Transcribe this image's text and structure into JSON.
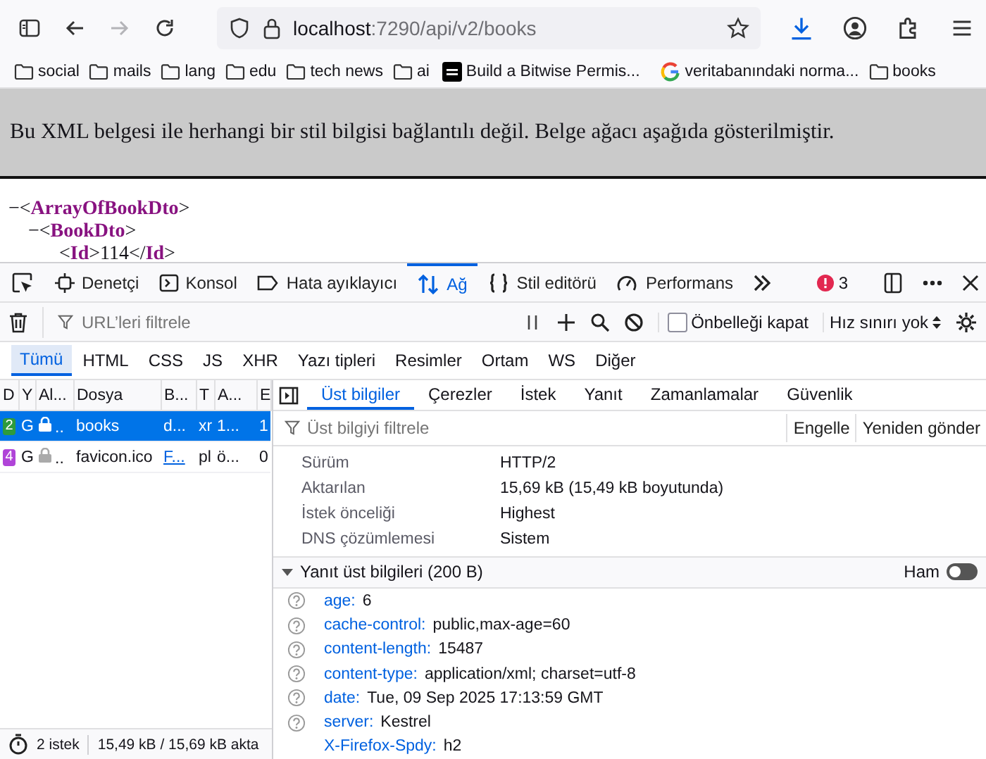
{
  "browser": {
    "nav": [
      {
        "kind": "sidebar",
        "disabled": false
      },
      {
        "kind": "back",
        "disabled": false
      },
      {
        "kind": "forward",
        "disabled": true
      },
      {
        "kind": "reload",
        "disabled": false
      }
    ],
    "address": {
      "host": "localhost",
      "path": ":7290/api/v2/books"
    },
    "bookmarks": [
      {
        "kind": "folder",
        "label": "social"
      },
      {
        "kind": "folder",
        "label": "mails"
      },
      {
        "kind": "folder",
        "label": "lang"
      },
      {
        "kind": "folder",
        "label": "edu"
      },
      {
        "kind": "folder",
        "label": "tech news"
      },
      {
        "kind": "folder",
        "label": "ai"
      },
      {
        "kind": "dev",
        "label": "Build a Bitwise Permis..."
      },
      {
        "kind": "google",
        "label": "veritabanındaki norma..."
      },
      {
        "kind": "folder",
        "label": "books"
      }
    ]
  },
  "page": {
    "notice": "Bu XML belgesi ile herhangi bir stil bilgisi bağlantılı değil. Belge ağacı aşağıda gösterilmiştir.",
    "xml": [
      {
        "segments": [
          {
            "kind": "mark",
            "text": "−<"
          },
          {
            "kind": "tag",
            "text": "ArrayOfBookDto"
          },
          {
            "kind": "mark",
            "text": ">"
          }
        ],
        "children": [
          {
            "segments": [
              {
                "kind": "mark",
                "text": "−<"
              },
              {
                "kind": "tag",
                "text": "BookDto"
              },
              {
                "kind": "mark",
                "text": ">"
              }
            ],
            "children": [
              {
                "segments": [
                  {
                    "kind": "mark",
                    "text": "<"
                  },
                  {
                    "kind": "tag",
                    "text": "Id"
                  },
                  {
                    "kind": "mark",
                    "text": ">114</"
                  },
                  {
                    "kind": "tag",
                    "text": "Id"
                  },
                  {
                    "kind": "mark",
                    "text": ">"
                  }
                ]
              }
            ]
          }
        ]
      }
    ]
  },
  "devtools": {
    "tools": [
      {
        "kind": "inspector",
        "label": "Denetçi",
        "selected": false
      },
      {
        "kind": "console",
        "label": "Konsol",
        "selected": false
      },
      {
        "kind": "debugger",
        "label": "Hata ayıklayıcı",
        "selected": false
      },
      {
        "kind": "network",
        "label": "Ağ",
        "selected": true
      },
      {
        "kind": "style",
        "label": "Stil editörü",
        "selected": false
      },
      {
        "kind": "performance",
        "label": "Performans",
        "selected": false
      }
    ],
    "error_count": "3",
    "filter": {
      "placeholder": "URL’leri filtrele"
    },
    "disable_cache": {
      "label": "Önbelleği kapat",
      "checked": false
    },
    "throttle": "Hız sınırı yok",
    "type_filters": [
      {
        "label": "Tümü",
        "selected": true
      },
      {
        "label": "HTML",
        "selected": false
      },
      {
        "label": "CSS",
        "selected": false
      },
      {
        "label": "JS",
        "selected": false
      },
      {
        "label": "XHR",
        "selected": false
      },
      {
        "label": "Yazı tipleri",
        "selected": false
      },
      {
        "label": "Resimler",
        "selected": false
      },
      {
        "label": "Ortam",
        "selected": false
      },
      {
        "label": "WS",
        "selected": false
      },
      {
        "label": "Diğer",
        "selected": false
      }
    ],
    "requests": {
      "columns": [
        "D",
        "Y",
        "Al...",
        "Dosya",
        "B...",
        "T",
        "A...",
        "E"
      ],
      "rows": [
        {
          "selected": true,
          "color": "#2e9b3c",
          "status": "2",
          "method": "G",
          "domain": "..",
          "file": "books",
          "cause": "d...",
          "cause_link": false,
          "type": "xr",
          "transferred": "1...",
          "size": "1"
        },
        {
          "selected": false,
          "color": "#b044d8",
          "status": "4",
          "method": "G",
          "domain": "..",
          "file": "favicon.ico",
          "cause": "F...",
          "cause_link": true,
          "type": "pl",
          "transferred": "ö...",
          "size": "0"
        }
      ]
    },
    "status_bar": {
      "requests": "2 istek",
      "transfer": "15,49 kB / 15,69 kB akta"
    },
    "details": {
      "tabs": [
        {
          "label": "Üst bilgiler",
          "selected": true
        },
        {
          "label": "Çerezler",
          "selected": false
        },
        {
          "label": "İstek",
          "selected": false
        },
        {
          "label": "Yanıt",
          "selected": false
        },
        {
          "label": "Zamanlamalar",
          "selected": false
        },
        {
          "label": "Güvenlik",
          "selected": false
        }
      ],
      "filter_placeholder": "Üst bilgiyi filtrele",
      "actions": [
        "Engelle",
        "Yeniden gönder"
      ],
      "summary": [
        {
          "label": "Sürüm",
          "value": "HTTP/2"
        },
        {
          "label": "Aktarılan",
          "value": "15,69 kB (15,49 kB boyutunda)"
        },
        {
          "label": "İstek önceliği",
          "value": "Highest"
        },
        {
          "label": "DNS çözümlemesi",
          "value": "Sistem"
        }
      ],
      "response_headers": {
        "title": "Yanıt üst bilgileri (200 B)",
        "expanded": true,
        "raw_label": "Ham",
        "raw_on": false,
        "headers": [
          {
            "name": "age:",
            "value": "6",
            "help": true
          },
          {
            "name": "cache-control:",
            "value": "public,max-age=60",
            "help": true
          },
          {
            "name": "content-length:",
            "value": "15487",
            "help": true
          },
          {
            "name": "content-type:",
            "value": "application/xml; charset=utf-8",
            "help": true
          },
          {
            "name": "date:",
            "value": "Tue, 09 Sep 2025 17:13:59 GMT",
            "help": true
          },
          {
            "name": "server:",
            "value": "Kestrel",
            "help": true
          },
          {
            "name": "X-Firefox-Spdy:",
            "value": "h2",
            "help": false
          }
        ]
      }
    }
  }
}
